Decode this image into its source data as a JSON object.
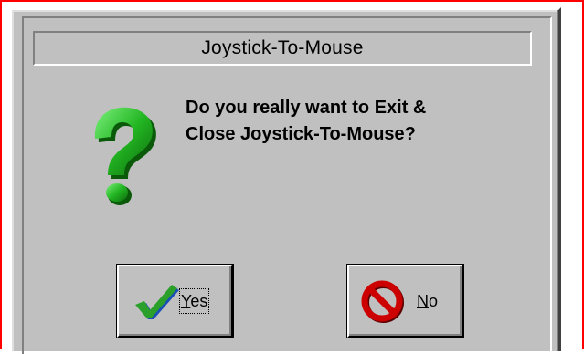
{
  "dialog": {
    "title": "Joystick-To-Mouse",
    "message_line1": "Do you really want to Exit &",
    "message_line2": "Close Joystick-To-Mouse?",
    "icon": "question-mark-icon",
    "buttons": {
      "yes": {
        "mnemonic": "Y",
        "rest": "es",
        "icon": "checkmark-icon",
        "focused": true
      },
      "no": {
        "mnemonic": "N",
        "rest": "o",
        "icon": "no-sign-icon"
      }
    }
  },
  "colors": {
    "dialog_face": "#c0c0c0",
    "outer_border": "#ff0000",
    "question_green": "#22b522",
    "check_green": "#2aa02a",
    "no_sign_red": "#cc0000"
  }
}
